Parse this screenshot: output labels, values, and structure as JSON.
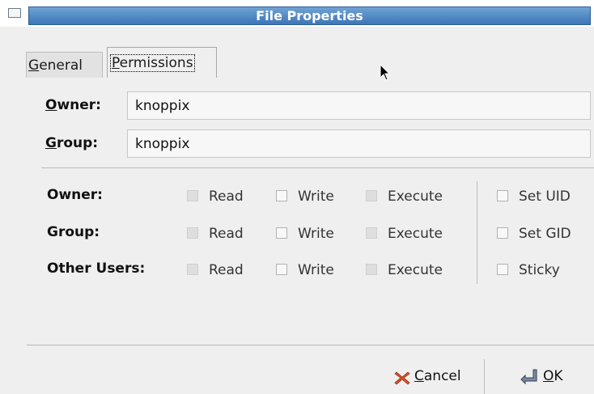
{
  "window": {
    "title": "File Properties"
  },
  "tabs": [
    {
      "label_ul": "G",
      "label_rest": "eneral",
      "active": false
    },
    {
      "label_ul": "P",
      "label_rest": "ermissions",
      "active": true
    }
  ],
  "ownership": {
    "owner": {
      "label_ul": "O",
      "label_rest": "wner:",
      "value": "knoppix"
    },
    "group": {
      "label_ul": "G",
      "label_rest": "roup:",
      "value": "knoppix"
    }
  },
  "permissions": {
    "rows": [
      {
        "label": "Owner:",
        "read": "Read",
        "write": "Write",
        "execute": "Execute",
        "special": "Set UID"
      },
      {
        "label": "Group:",
        "read": "Read",
        "write": "Write",
        "execute": "Execute",
        "special": "Set GID"
      },
      {
        "label": "Other Users:",
        "read": "Read",
        "write": "Write",
        "execute": "Execute",
        "special": "Sticky"
      }
    ]
  },
  "buttons": {
    "cancel": {
      "label_ul": "C",
      "label_rest": "ancel",
      "icon": "x-icon",
      "color": "#d4502a"
    },
    "ok": {
      "label_ul": "O",
      "label_rest": "K",
      "icon": "enter-arrow-icon"
    }
  },
  "colors": {
    "titlebar": "#3d77b8",
    "background": "#efefef"
  }
}
